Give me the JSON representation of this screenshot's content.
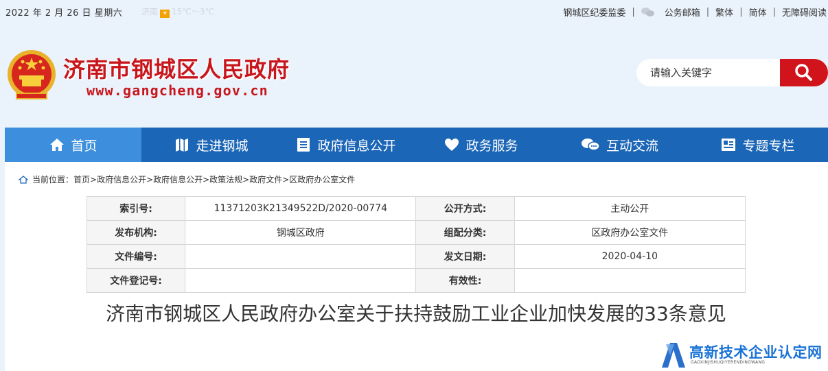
{
  "topbar": {
    "date": "2022 年 2 月 26 日 星期六",
    "weather_city": "济南",
    "weather_temp": "15℃～3℃",
    "links": {
      "discipline": "钢城区纪委监委",
      "mailbox": "公务邮箱",
      "traditional": "繁体",
      "simplified": "简体",
      "accessible": "无障碍阅读"
    }
  },
  "header": {
    "title": "济南市钢城区人民政府",
    "url": "www.gangcheng.gov.cn",
    "search_placeholder": "请输入关键字"
  },
  "nav": {
    "items": [
      {
        "label": "首页",
        "icon": "home-icon"
      },
      {
        "label": "走进钢城",
        "icon": "map-icon"
      },
      {
        "label": "政府信息公开",
        "icon": "document-list-icon"
      },
      {
        "label": "政务服务",
        "icon": "heart-icon"
      },
      {
        "label": "互动交流",
        "icon": "chat-bubbles-icon"
      },
      {
        "label": "专题专栏",
        "icon": "news-icon"
      }
    ]
  },
  "breadcrumb": {
    "prefix": "当前位置：",
    "path": "首页>政府信息公开>政府信息公开>政策法规>政府文件>区政府办公室文件"
  },
  "meta_table": {
    "rows": [
      {
        "l1": "索引号:",
        "v1": "11371203K21349522D/2020-00774",
        "l2": "公开方式:",
        "v2": "主动公开"
      },
      {
        "l1": "发布机构:",
        "v1": "钢城区政府",
        "l2": "组配分类:",
        "v2": "区政府办公室文件"
      },
      {
        "l1": "文件编号:",
        "v1": "",
        "l2": "发文日期:",
        "v2": "2020-04-10"
      },
      {
        "l1": "文件登记号:",
        "v1": "",
        "l2": "有效性:",
        "v2": ""
      }
    ]
  },
  "document": {
    "title": "济南市钢城区人民政府办公室关于扶持鼓励工业企业加快发展的33条意见"
  },
  "watermark": {
    "title": "高新技术企业认定网",
    "subtitle": "GAOXINJISHUQIYERENDINGWANG"
  },
  "colors": {
    "brand_red": "#c8161d",
    "nav_blue": "#1c66b7",
    "nav_active": "#3d8fdd",
    "page_bg": "#eaf2fb"
  }
}
